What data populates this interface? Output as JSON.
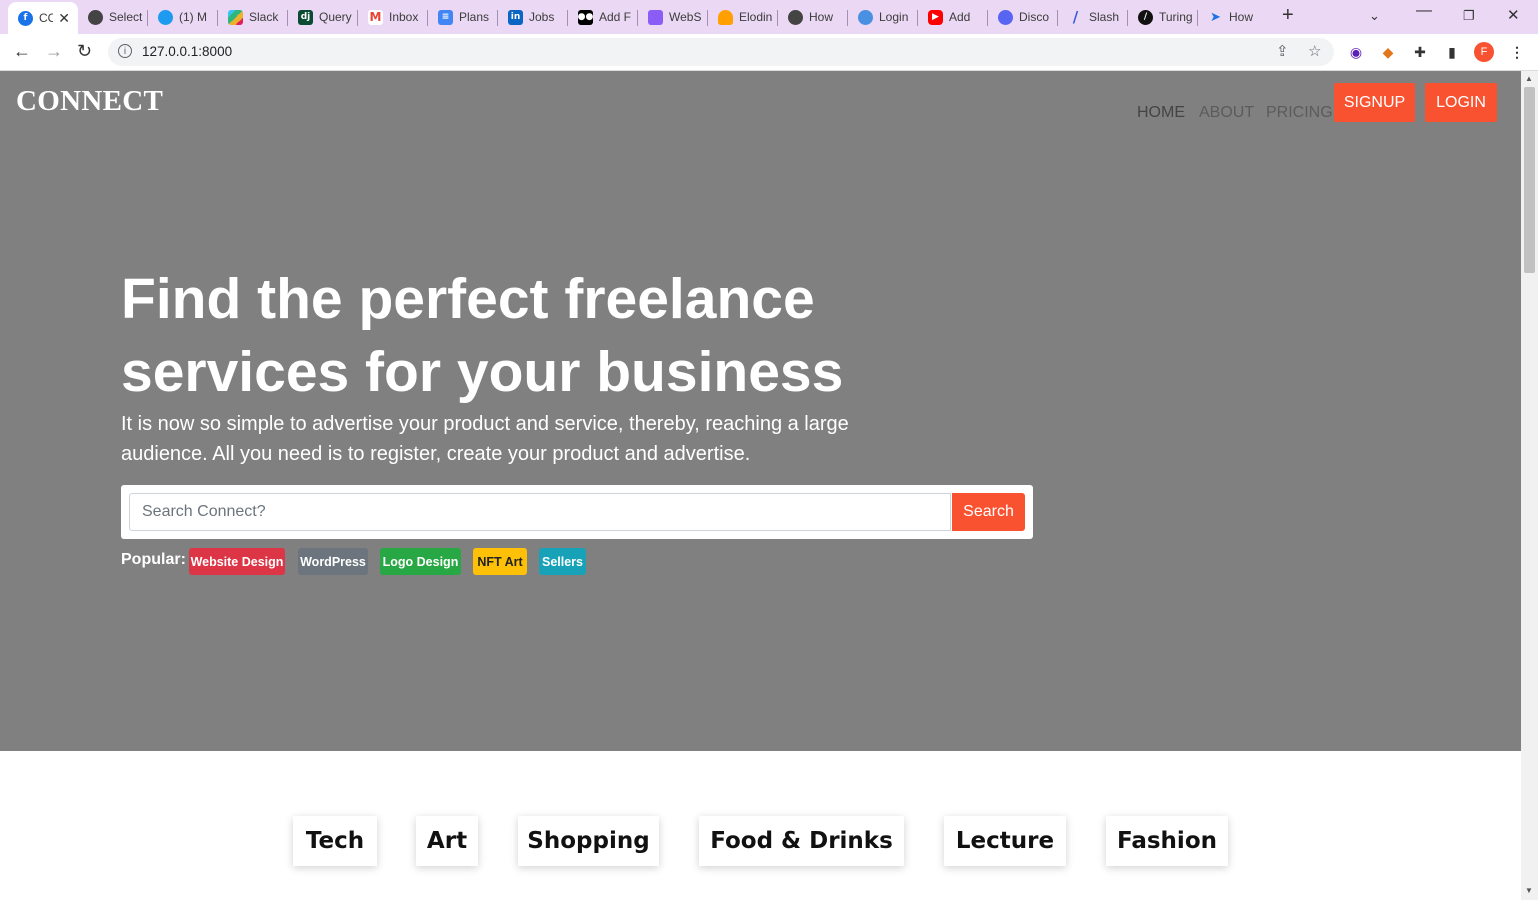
{
  "browser": {
    "tabs": [
      {
        "title": "CONNECT",
        "icon": "connect-favicon",
        "color": "#1a73e8"
      },
      {
        "title": "Select",
        "icon": "globe-icon",
        "color": "#555555"
      },
      {
        "title": "(1) M",
        "icon": "twitter-icon",
        "color": "#1d9bf0"
      },
      {
        "title": "Slack",
        "icon": "slack-icon",
        "color": "#611f69"
      },
      {
        "title": "Query",
        "icon": "django-icon",
        "color": "#0c4b33"
      },
      {
        "title": "Inbox",
        "icon": "gmail-icon",
        "color": "#ea4335"
      },
      {
        "title": "Plans",
        "icon": "docs-icon",
        "color": "#4285f4"
      },
      {
        "title": "Jobs",
        "icon": "linkedin-icon",
        "color": "#0a66c2"
      },
      {
        "title": "Add F",
        "icon": "medium-icon",
        "color": "#000000"
      },
      {
        "title": "WebS",
        "icon": "websocket-icon",
        "color": "#8b5cf6"
      },
      {
        "title": "Elodin",
        "icon": "firebase-icon",
        "color": "#ffa000"
      },
      {
        "title": "How",
        "icon": "globe-icon",
        "color": "#555555"
      },
      {
        "title": "Login",
        "icon": "login-icon",
        "color": "#4a90e2"
      },
      {
        "title": "Add",
        "icon": "youtube-icon",
        "color": "#ff0000"
      },
      {
        "title": "Disco",
        "icon": "discord-icon",
        "color": "#5865f2"
      },
      {
        "title": "Slash",
        "icon": "slash-icon",
        "color": "#3b5bdb"
      },
      {
        "title": "Turing",
        "icon": "turing-icon",
        "color": "#111111"
      },
      {
        "title": "How",
        "icon": "arrow-icon",
        "color": "#1a73e8"
      }
    ],
    "url": "127.0.0.1:8000",
    "profile_initial": "F"
  },
  "site": {
    "brand": "CONNECT",
    "nav": {
      "home": "HOME",
      "about": "ABOUT",
      "pricing": "PRICING",
      "signup": "SIGNUP",
      "login": "LOGIN"
    },
    "hero": {
      "headline_line1": "Find the perfect freelance",
      "headline_line2": "services for your business",
      "subtitle": "It is now so simple to advertise your product and service, thereby, reaching a large audience. All you need is to register, create your product and advertise."
    },
    "search": {
      "placeholder": "Search Connect?",
      "button": "Search"
    },
    "popular": {
      "label": "Popular:",
      "tags": [
        {
          "label": "Website Design",
          "color": "#dc3545"
        },
        {
          "label": "WordPress",
          "color": "#6c757d"
        },
        {
          "label": "Logo Design",
          "color": "#28a745"
        },
        {
          "label": "NFT Art",
          "color": "#ffc107"
        },
        {
          "label": "Sellers",
          "color": "#17a2b8"
        }
      ]
    },
    "categories": [
      "Tech",
      "Art",
      "Shopping",
      "Food & Drinks",
      "Lecture",
      "Fashion"
    ],
    "accent": "#f95230",
    "hero_background": "#808080"
  }
}
